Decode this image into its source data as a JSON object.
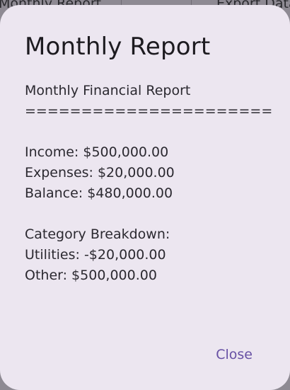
{
  "background": {
    "left_tab": "Monthly Report",
    "right_tab": "Export Data"
  },
  "dialog": {
    "title": "Monthly Report",
    "report_heading": "Monthly Financial Report",
    "separator": "======================",
    "income": "Income: $500,000.00",
    "expenses": "Expenses: $20,000.00",
    "balance": "Balance: $480,000.00",
    "category_heading": "Category Breakdown:",
    "categories": [
      "Utilities: -$20,000.00",
      "Other: $500,000.00"
    ],
    "close_label": "Close"
  },
  "colors": {
    "dialog_background": "#ece6f0",
    "accent": "#6750a4",
    "scrim": "#8e8a93"
  }
}
